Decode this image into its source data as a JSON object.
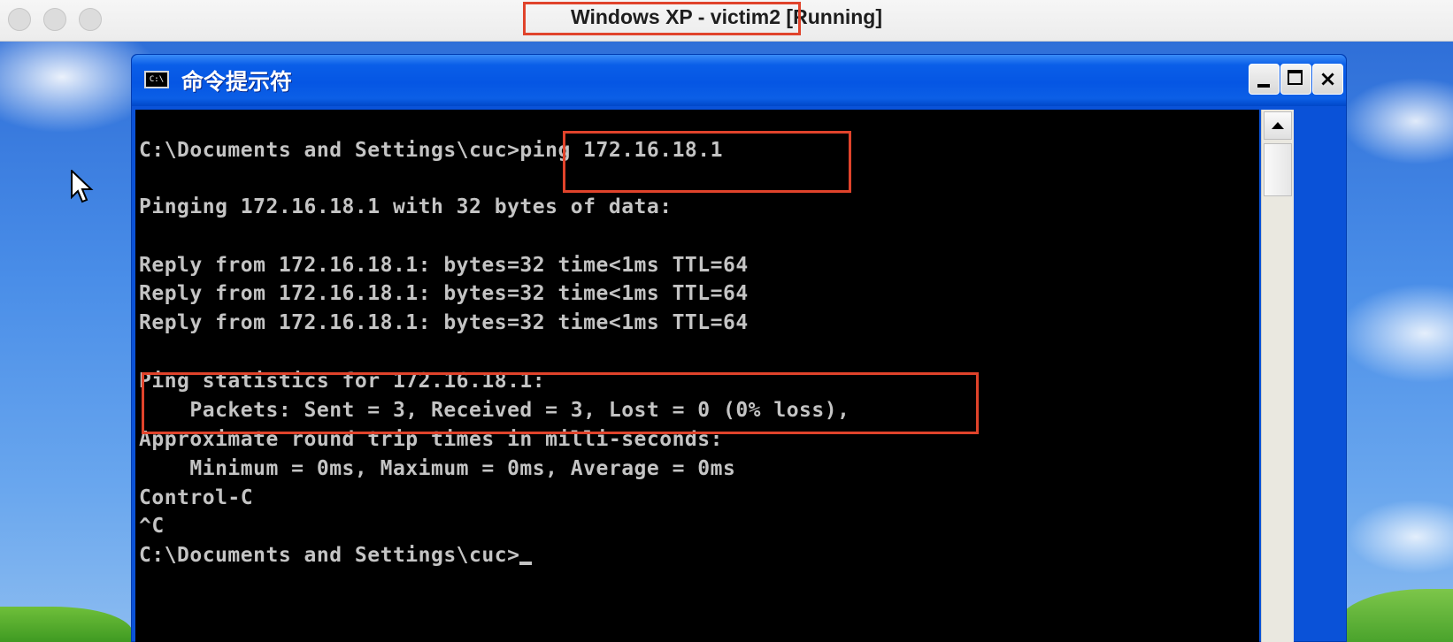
{
  "host_window": {
    "title_vm": "Windows XP - victim2",
    "title_state": "Running"
  },
  "cmd_window": {
    "title": "命令提示符",
    "icon_label": "C:\\",
    "buttons": {
      "minimize": "minimize",
      "maximize": "maximize",
      "close": "×"
    }
  },
  "console": {
    "lines": [
      "C:\\Documents and Settings\\cuc>ping 172.16.18.1",
      "Pinging 172.16.18.1 with 32 bytes of data:",
      "Reply from 172.16.18.1: bytes=32 time<1ms TTL=64",
      "Reply from 172.16.18.1: bytes=32 time<1ms TTL=64",
      "Reply from 172.16.18.1: bytes=32 time<1ms TTL=64",
      "Ping statistics for 172.16.18.1:",
      "    Packets: Sent = 3, Received = 3, Lost = 0 (0% loss),",
      "Approximate round trip times in milli-seconds:",
      "    Minimum = 0ms, Maximum = 0ms, Average = 0ms",
      "Control-C",
      "^C",
      "C:\\Documents and Settings\\cuc>"
    ]
  }
}
